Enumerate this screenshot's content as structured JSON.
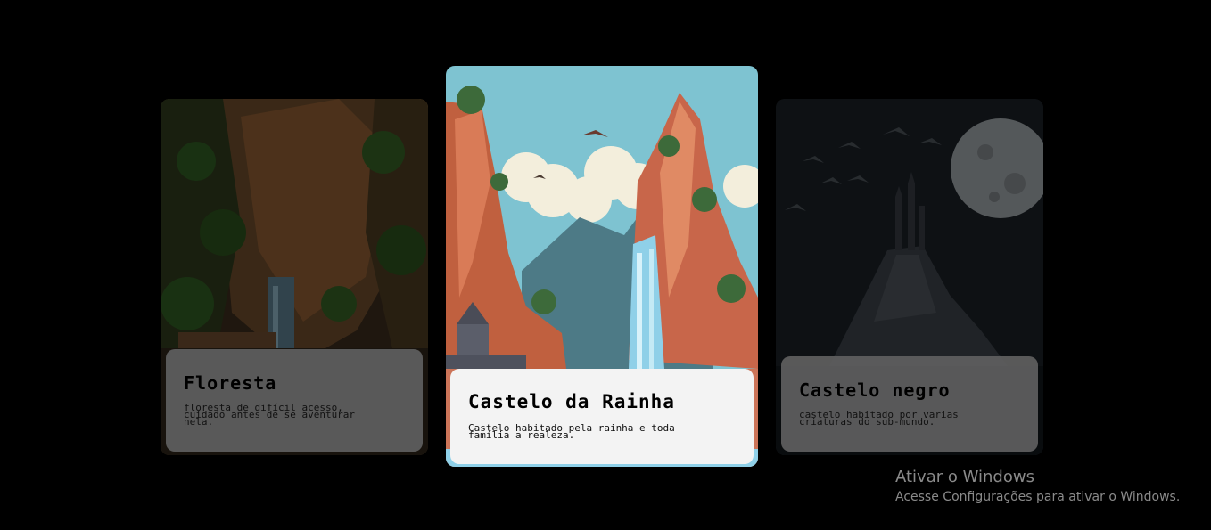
{
  "cards": [
    {
      "id": "floresta",
      "title": "Floresta",
      "description": "floresta de difícil acesso,\ncuidado antes de se aventurar\nnela."
    },
    {
      "id": "castelo-da-rainha",
      "title": "Castelo da Rainha",
      "description": "Castelo habitado pela rainha e toda\nfamília a realeza."
    },
    {
      "id": "castelo-negro",
      "title": "Castelo negro",
      "description": "castelo habitado por varias\ncriaturas do sub-mundo."
    }
  ],
  "windows_watermark": {
    "title": "Ativar o Windows",
    "subtitle": "Acesse Configurações para ativar o Windows."
  },
  "colors": {
    "background": "#000000",
    "active_panel": "#f3f3f3",
    "inactive_panel": "#5f5f5f",
    "sky": "#7ec3d1",
    "cliff": "#c8664a"
  }
}
